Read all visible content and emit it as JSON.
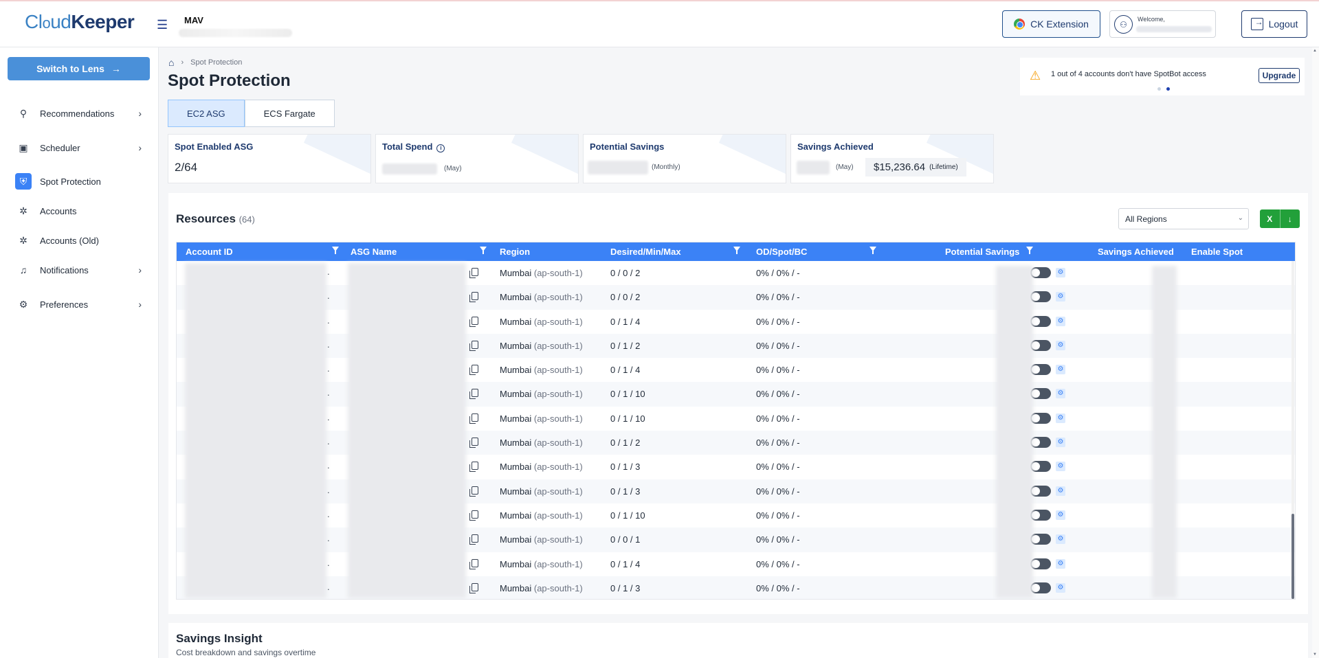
{
  "header": {
    "logo_a": "Cl",
    "logo_b": "ud",
    "logo_c": "Keeper",
    "org_name": "MAV",
    "ext_label": "CK Extension",
    "welcome": "Welcome,",
    "logout_label": "Logout"
  },
  "sidebar": {
    "switch_label": "Switch to Lens",
    "items": [
      {
        "label": "Recommendations",
        "icon": "recommendations-icon",
        "chevron": true
      },
      {
        "label": "Scheduler",
        "icon": "scheduler-icon",
        "chevron": true
      },
      {
        "label": "Spot Protection",
        "icon": "spot-protection-icon",
        "chevron": false,
        "active": true
      },
      {
        "label": "Accounts",
        "icon": "accounts-icon",
        "chevron": false
      },
      {
        "label": "Accounts (Old)",
        "icon": "accounts-old-icon",
        "chevron": false
      },
      {
        "label": "Notifications",
        "icon": "bell-icon",
        "chevron": true
      },
      {
        "label": "Preferences",
        "icon": "gear-icon",
        "chevron": true
      }
    ]
  },
  "breadcrumb": {
    "current": "Spot Protection"
  },
  "page": {
    "title": "Spot Protection"
  },
  "tabs": [
    {
      "label": "EC2 ASG",
      "active": true
    },
    {
      "label": "ECS Fargate",
      "active": false
    }
  ],
  "notice": {
    "text": "1 out of 4 accounts don't have SpotBot access",
    "button": "Upgrade"
  },
  "cards": {
    "spot_enabled": {
      "title": "Spot Enabled ASG",
      "value": "2/64"
    },
    "total_spend": {
      "title": "Total Spend",
      "period": "(May)"
    },
    "potential_savings": {
      "title": "Potential Savings",
      "period": "(Monthly)"
    },
    "savings_achieved": {
      "title": "Savings Achieved",
      "period": "(May)",
      "lifetime_value": "$15,236.64",
      "lifetime_label": "(Lifetime)"
    }
  },
  "resources": {
    "title": "Resources",
    "count": "(64)",
    "region_filter": "All Regions",
    "columns": [
      "Account ID",
      "ASG Name",
      "Region",
      "Desired/Min/Max",
      "OD/Spot/BC",
      "Potential Savings",
      "Savings Achieved",
      "Enable Spot"
    ],
    "rows": [
      {
        "region": "Mumbai",
        "region_code": "(ap-south-1)",
        "dmm": "0 / 0 / 2",
        "odspot": "0% / 0% / -"
      },
      {
        "region": "Mumbai",
        "region_code": "(ap-south-1)",
        "dmm": "0 / 0 / 2",
        "odspot": "0% / 0% / -"
      },
      {
        "region": "Mumbai",
        "region_code": "(ap-south-1)",
        "dmm": "0 / 1 / 4",
        "odspot": "0% / 0% / -"
      },
      {
        "region": "Mumbai",
        "region_code": "(ap-south-1)",
        "dmm": "0 / 1 / 2",
        "odspot": "0% / 0% / -"
      },
      {
        "region": "Mumbai",
        "region_code": "(ap-south-1)",
        "dmm": "0 / 1 / 4",
        "odspot": "0% / 0% / -"
      },
      {
        "region": "Mumbai",
        "region_code": "(ap-south-1)",
        "dmm": "0 / 1 / 10",
        "odspot": "0% / 0% / -"
      },
      {
        "region": "Mumbai",
        "region_code": "(ap-south-1)",
        "dmm": "0 / 1 / 10",
        "odspot": "0% / 0% / -"
      },
      {
        "region": "Mumbai",
        "region_code": "(ap-south-1)",
        "dmm": "0 / 1 / 2",
        "odspot": "0% / 0% / -"
      },
      {
        "region": "Mumbai",
        "region_code": "(ap-south-1)",
        "dmm": "0 / 1 / 3",
        "odspot": "0% / 0% / -"
      },
      {
        "region": "Mumbai",
        "region_code": "(ap-south-1)",
        "dmm": "0 / 1 / 3",
        "odspot": "0% / 0% / -"
      },
      {
        "region": "Mumbai",
        "region_code": "(ap-south-1)",
        "dmm": "0 / 1 / 10",
        "odspot": "0% / 0% / -"
      },
      {
        "region": "Mumbai",
        "region_code": "(ap-south-1)",
        "dmm": "0 / 0 / 1",
        "odspot": "0% / 0% / -"
      },
      {
        "region": "Mumbai",
        "region_code": "(ap-south-1)",
        "dmm": "0 / 1 / 4",
        "odspot": "0% / 0% / -"
      },
      {
        "region": "Mumbai",
        "region_code": "(ap-south-1)",
        "dmm": "0 / 1 / 3",
        "odspot": "0% / 0% / -"
      }
    ]
  },
  "insight": {
    "title": "Savings Insight",
    "subtitle": "Cost breakdown and savings overtime"
  }
}
